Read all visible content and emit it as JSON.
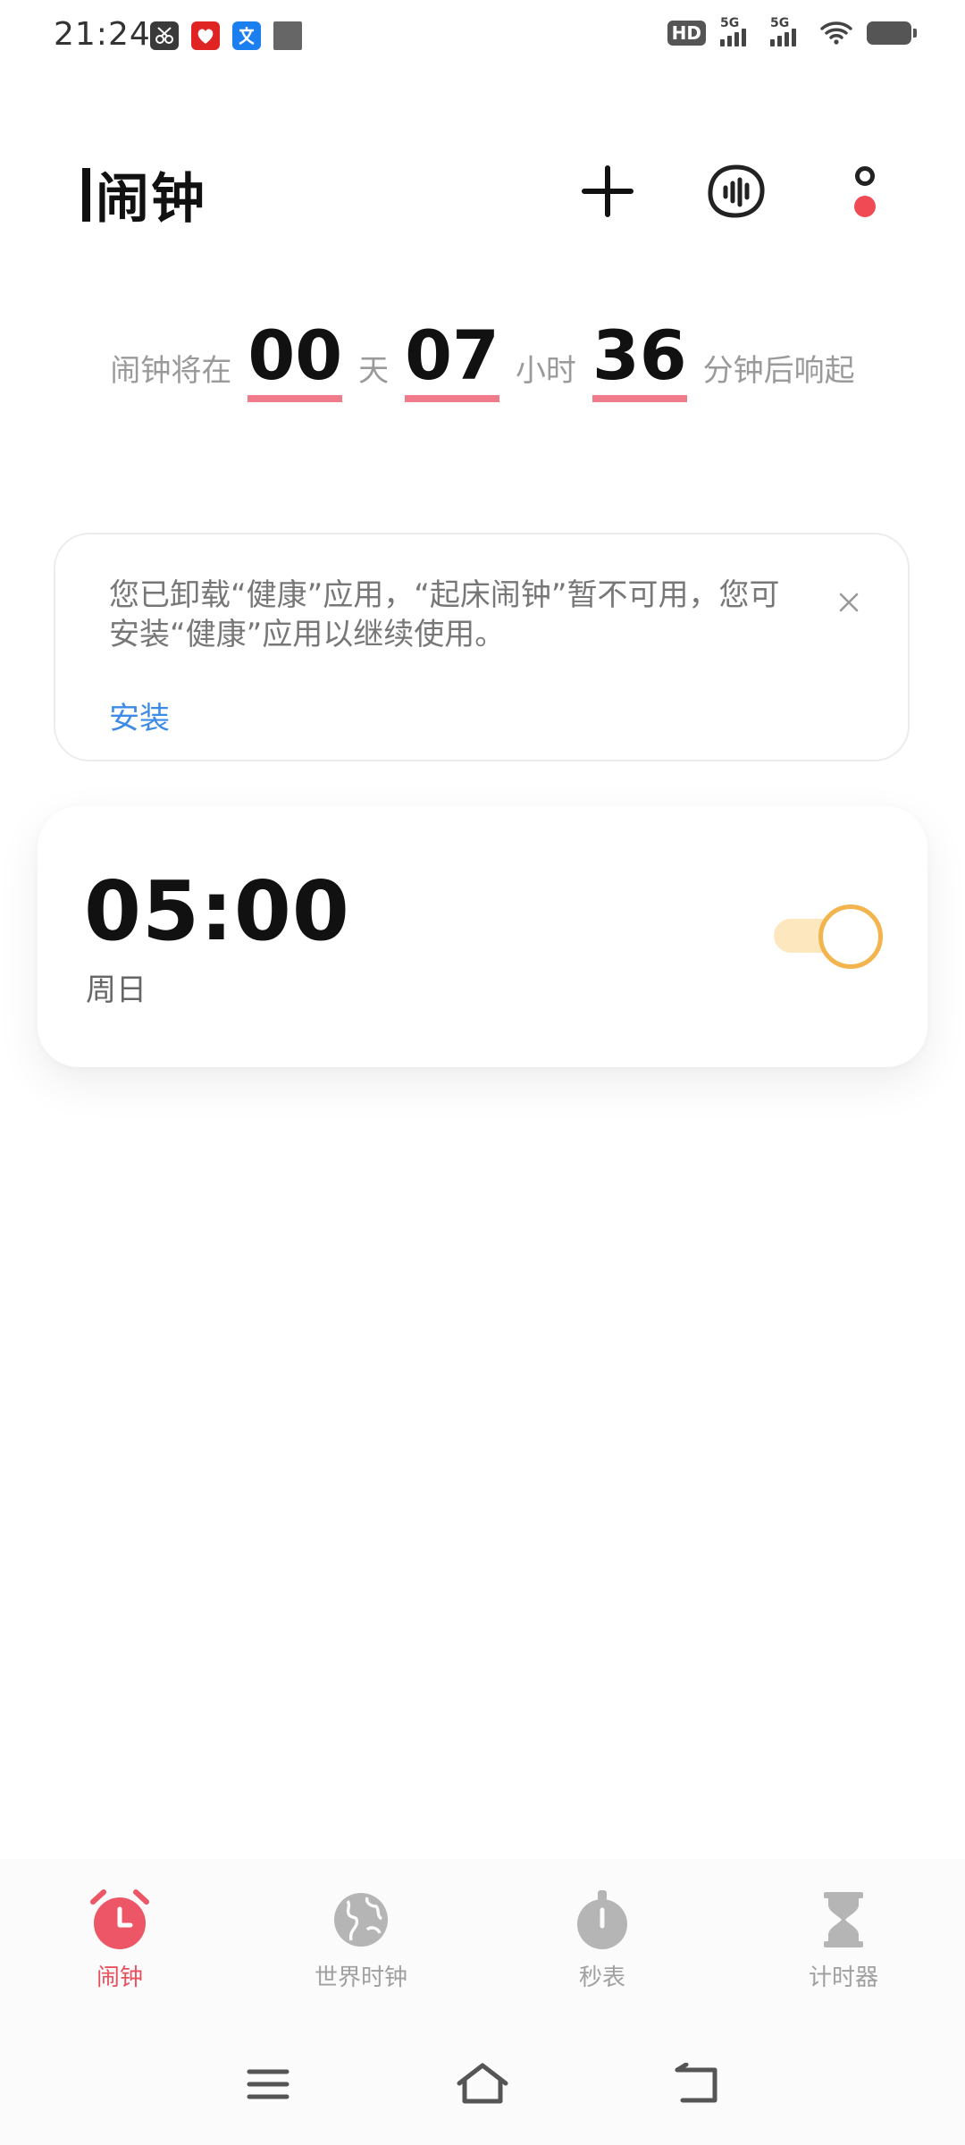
{
  "status_bar": {
    "time": "21:24",
    "left_icons": [
      "scissors-app-icon",
      "red-app-icon",
      "translate-app-icon",
      "gray-square-icon"
    ],
    "hd_label": "HD",
    "signal_1_label": "5G",
    "signal_2_label": "5G"
  },
  "header": {
    "title": "闹钟"
  },
  "countdown": {
    "prefix": "闹钟将在",
    "days": "00",
    "days_unit": "天",
    "hours": "07",
    "hours_unit": "小时",
    "minutes": "36",
    "suffix": "分钟后响起"
  },
  "notice": {
    "message": "您已卸载“健康”应用，“起床闹钟”暂不可用，您可安装“健康”应用以继续使用。",
    "install_label": "安装"
  },
  "alarm": {
    "time": "05:00",
    "repeat": "周日",
    "enabled": true
  },
  "bottom_nav": {
    "items": [
      {
        "label": "闹钟",
        "icon": "alarm-clock-icon",
        "active": true
      },
      {
        "label": "世界时钟",
        "icon": "globe-icon",
        "active": false
      },
      {
        "label": "秒表",
        "icon": "stopwatch-icon",
        "active": false
      },
      {
        "label": "计时器",
        "icon": "hourglass-icon",
        "active": false
      }
    ]
  },
  "colors": {
    "accent": "#e8505e",
    "toggle_on": "#f3b44e",
    "link": "#3d8be6"
  }
}
